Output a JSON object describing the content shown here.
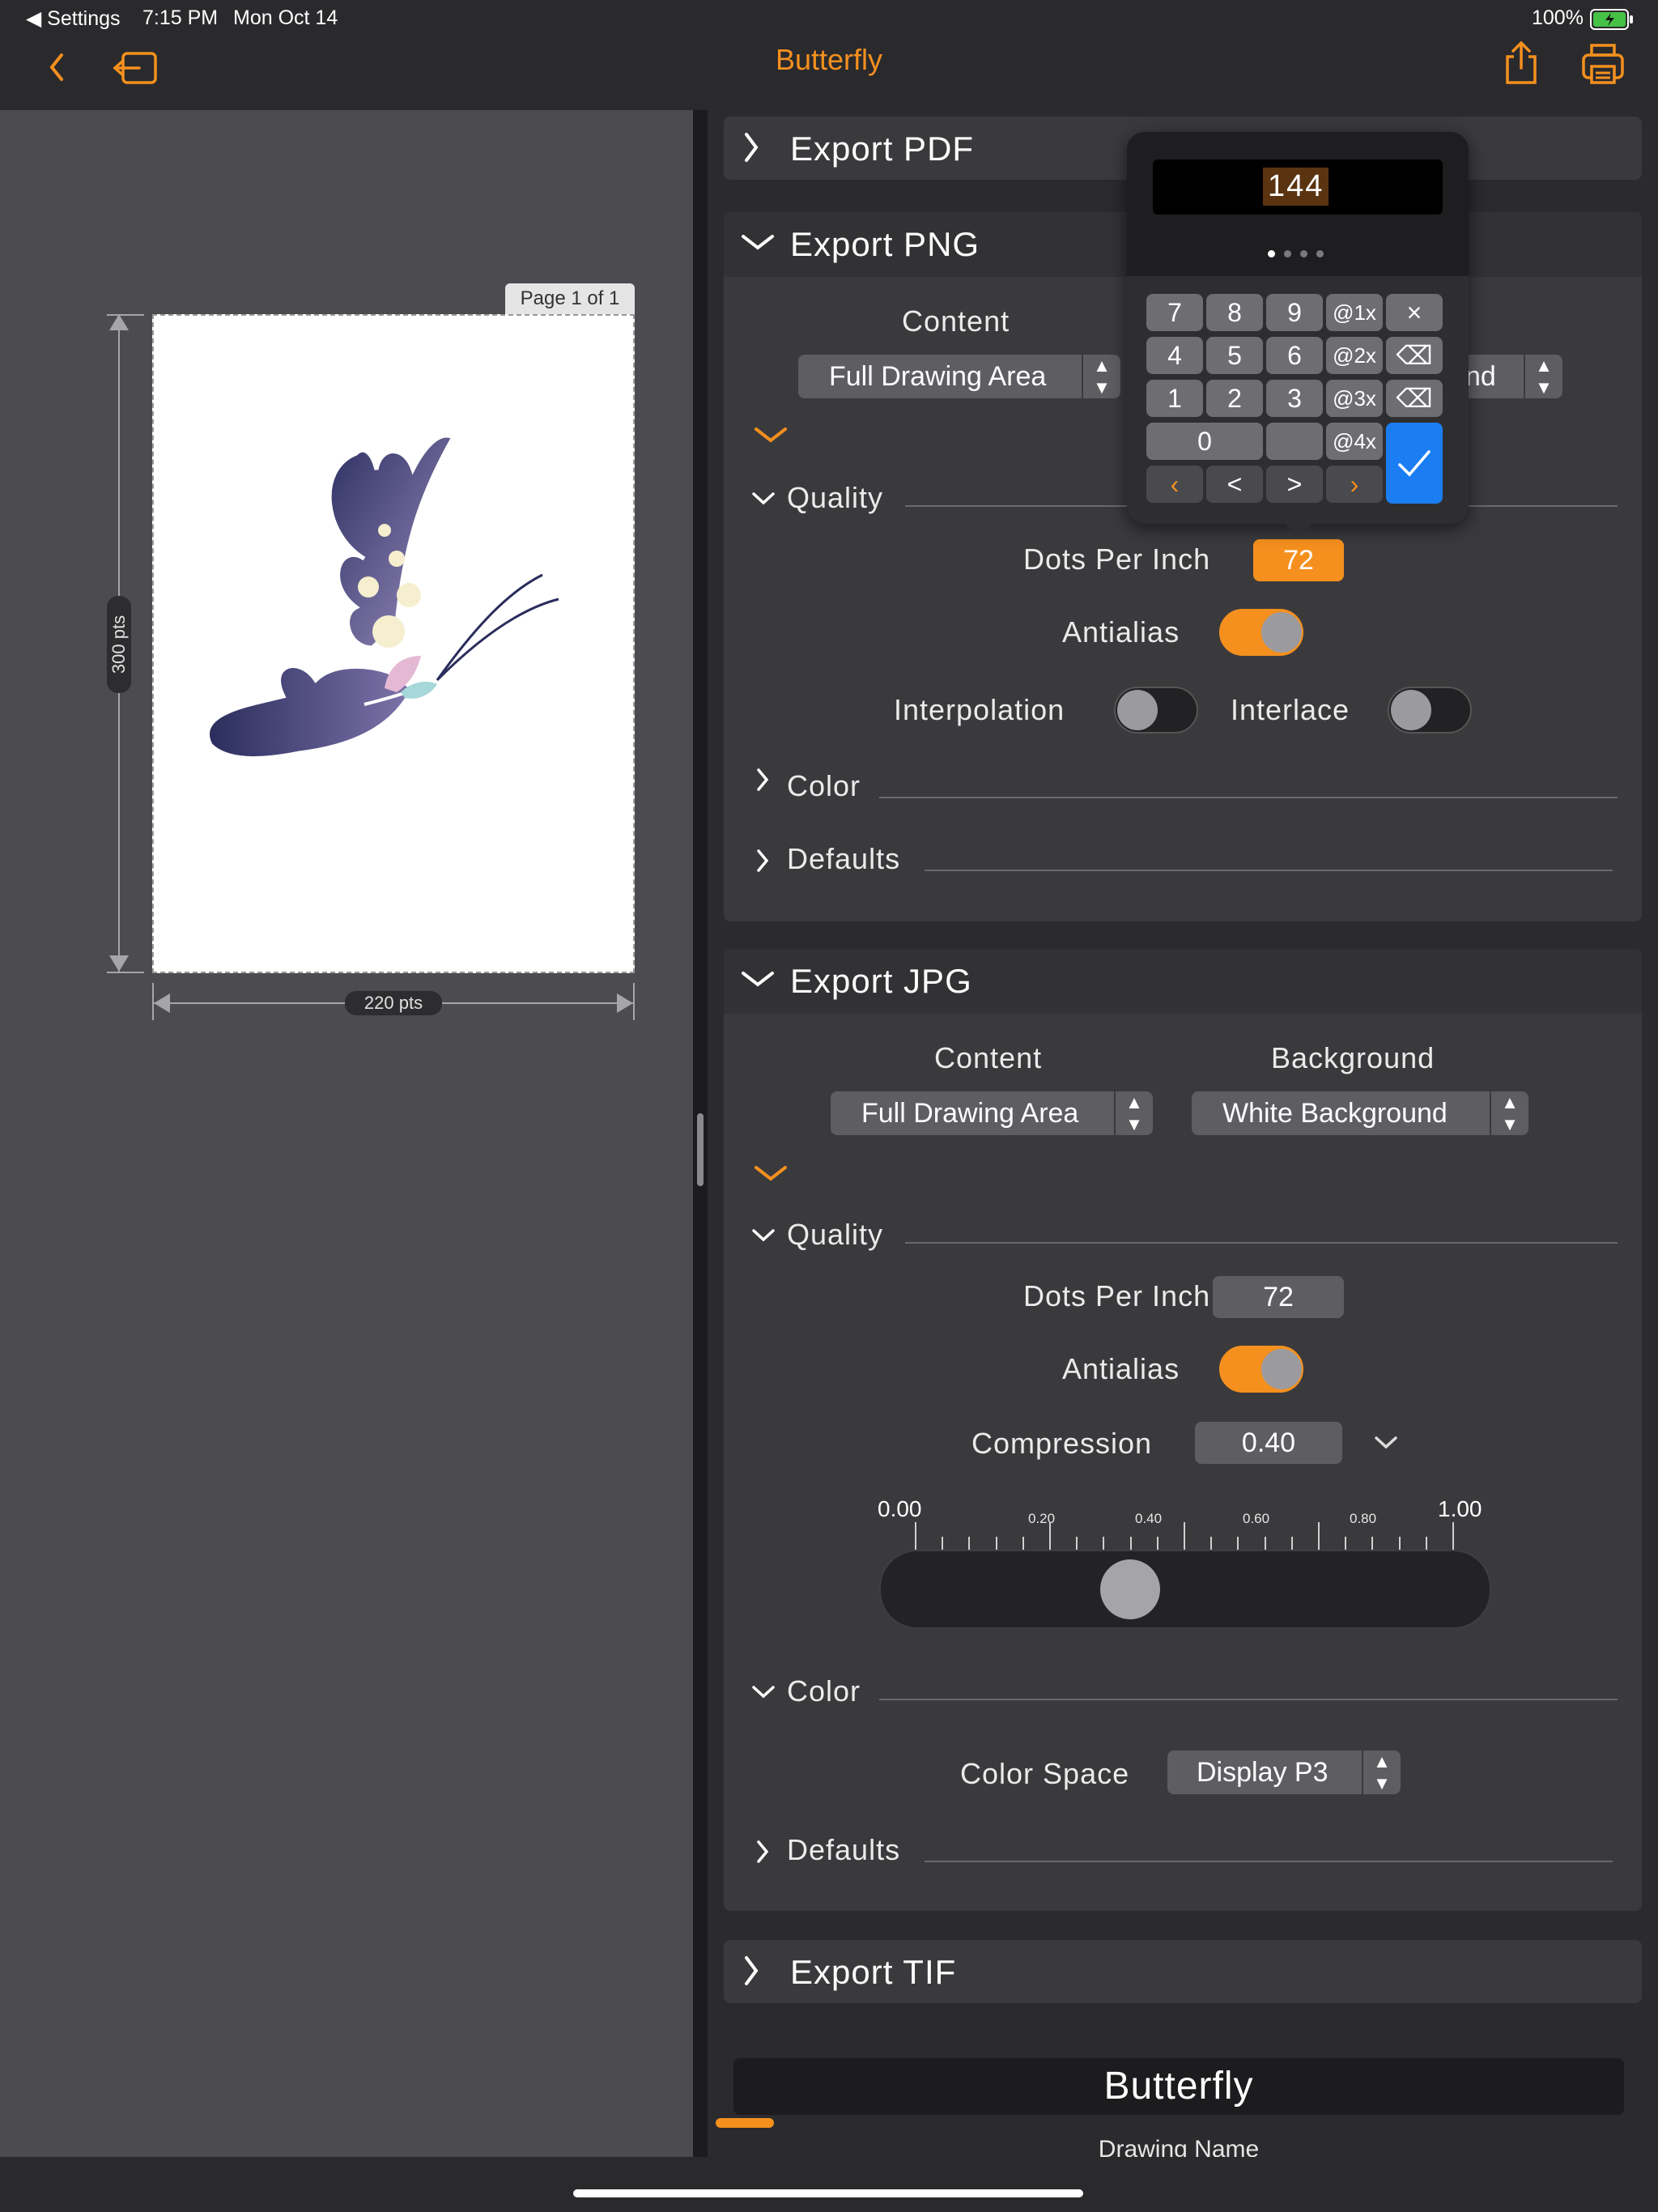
{
  "status_bar": {
    "back_app": "◀ Settings",
    "time": "7:15 PM",
    "date": "Mon Oct 14",
    "battery": "100%"
  },
  "nav": {
    "title": "Butterfly",
    "back_icon": "chevron-left-icon",
    "exit_icon": "exit-icon",
    "share_icon": "share-icon",
    "print_icon": "print-icon"
  },
  "preview": {
    "page_badge": "Page 1 of 1",
    "height_label": "300 pts",
    "width_label": "220 pts"
  },
  "export_pdf": {
    "title": "Export PDF",
    "expanded": false
  },
  "export_png": {
    "title": "Export PNG",
    "content_label": "Content",
    "content_value": "Full Drawing Area",
    "background_value_partial": "nd",
    "quality_label": "Quality",
    "dpi_label": "Dots Per Inch",
    "dpi_value": "72",
    "antialias_label": "Antialias",
    "antialias_on": true,
    "interpolation_label": "Interpolation",
    "interpolation_on": false,
    "interlace_label": "Interlace",
    "interlace_on": false,
    "color_label": "Color",
    "defaults_label": "Defaults"
  },
  "keypad": {
    "display": "144",
    "rows": [
      [
        "7",
        "8",
        "9",
        "@1x",
        "×"
      ],
      [
        "4",
        "5",
        "6",
        "@2x",
        "⌫"
      ],
      [
        "1",
        "2",
        "3",
        "@3x",
        "⌫"
      ],
      [
        "0",
        "",
        "@4x"
      ]
    ],
    "nav_keys": [
      "‹",
      "<",
      ">",
      "›"
    ],
    "confirm_icon": "checkmark-icon"
  },
  "export_jpg": {
    "title": "Export JPG",
    "content_label": "Content",
    "background_label": "Background",
    "content_value": "Full Drawing Area",
    "background_value": "White Background",
    "quality_label": "Quality",
    "dpi_label": "Dots Per Inch",
    "dpi_value": "72",
    "antialias_label": "Antialias",
    "antialias_on": true,
    "compression_label": "Compression",
    "compression_value": "0.40",
    "slider": {
      "min_label": "0.00",
      "max_label": "1.00",
      "tick_labels": [
        "0.20",
        "0.40",
        "0.60",
        "0.80"
      ],
      "value": 0.4
    },
    "color_label": "Color",
    "color_space_label": "Color Space",
    "color_space_value": "Display P3",
    "defaults_label": "Defaults"
  },
  "export_tif": {
    "title": "Export TIF",
    "expanded": false
  },
  "drawing": {
    "name": "Butterfly",
    "name_caption": "Drawing Name"
  },
  "colors": {
    "accent": "#f5901e",
    "confirm": "#1a7ef2"
  }
}
